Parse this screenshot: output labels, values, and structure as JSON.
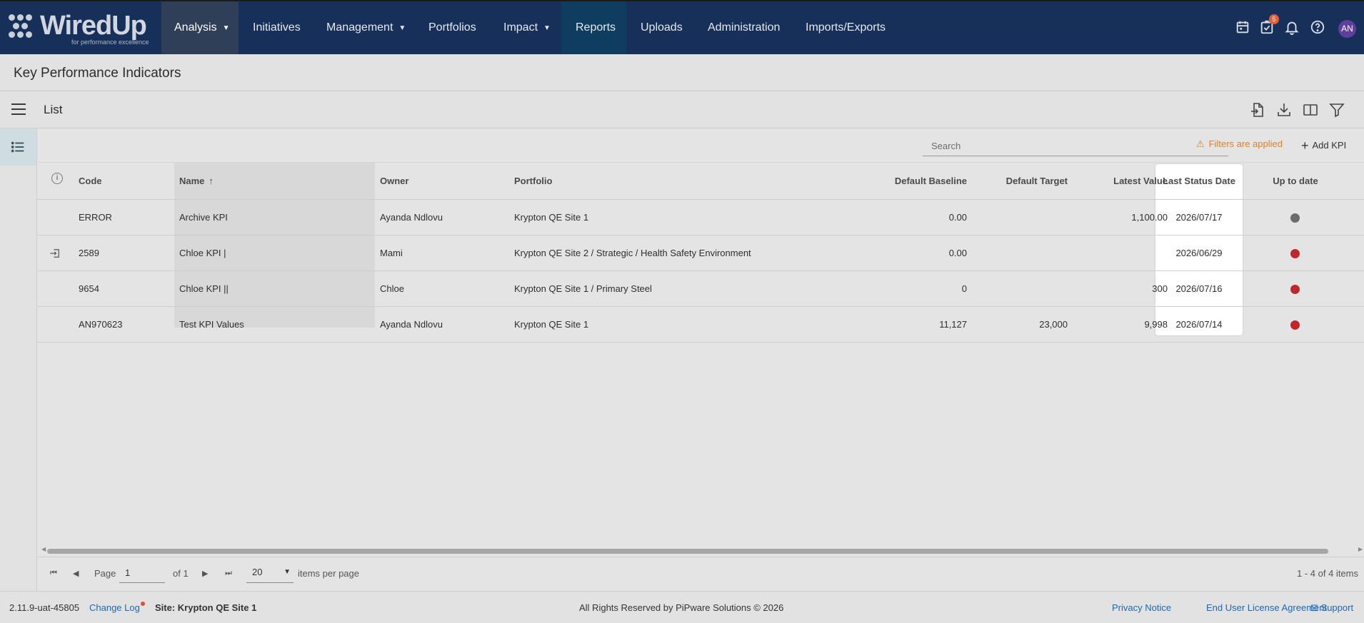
{
  "app": {
    "logo_text": "WiredUp",
    "logo_tagline": "for performance excellence"
  },
  "nav": {
    "items": [
      {
        "label": "Analysis",
        "has_dropdown": true,
        "active": true
      },
      {
        "label": "Initiatives",
        "has_dropdown": false
      },
      {
        "label": "Management",
        "has_dropdown": true
      },
      {
        "label": "Portfolios",
        "has_dropdown": false
      },
      {
        "label": "Impact",
        "has_dropdown": true
      },
      {
        "label": "Reports",
        "has_dropdown": false
      },
      {
        "label": "Uploads",
        "has_dropdown": false
      },
      {
        "label": "Administration",
        "has_dropdown": false
      },
      {
        "label": "Imports/Exports",
        "has_dropdown": false
      }
    ],
    "icons": [
      "calendar-icon",
      "task-list-icon",
      "bell-icon",
      "help-icon"
    ],
    "task_badge": "5",
    "avatar": "AN"
  },
  "page": {
    "title": "Key Performance Indicators",
    "view_title": "List"
  },
  "toolbar": {
    "search_placeholder": "Search",
    "filters_note": "Filters are applied",
    "add_label": "Add KPI"
  },
  "table": {
    "columns": [
      "Code",
      "Name",
      "Owner",
      "Portfolio",
      "Default Baseline",
      "Default Target",
      "Latest Value",
      "Last Status Date",
      "Up to date"
    ],
    "sort": {
      "column": "Name",
      "direction": "asc"
    },
    "rows": [
      {
        "code": "ERROR",
        "name": "Archive KPI",
        "owner": "Ayanda Ndlovu",
        "portfolio": "Krypton QE Site 1",
        "baseline": "0.00",
        "target": "",
        "latest": "1,100.00",
        "status_date": "2026/07/17",
        "up_to_date": "grey",
        "linked": false
      },
      {
        "code": "2589",
        "name": "Chloe KPI |",
        "owner": "Mami",
        "portfolio": "Krypton QE Site 2 / Strategic / Health Safety Environment",
        "baseline": "0.00",
        "target": "",
        "latest": "",
        "status_date": "2026/06/29",
        "up_to_date": "red",
        "linked": true
      },
      {
        "code": "9654",
        "name": "Chloe KPI ||",
        "owner": "Chloe",
        "portfolio": "Krypton QE Site 1 / Primary Steel",
        "baseline": "0",
        "target": "",
        "latest": "300",
        "status_date": "2026/07/16",
        "up_to_date": "red",
        "linked": false
      },
      {
        "code": "AN970623",
        "name": "Test KPI Values",
        "owner": "Ayanda Ndlovu",
        "portfolio": "Krypton QE Site 1",
        "baseline": "11,127",
        "target": "23,000",
        "latest": "9,998",
        "status_date": "2026/07/14",
        "up_to_date": "red",
        "linked": false
      }
    ]
  },
  "pager": {
    "page_label": "Page",
    "page_value": "1",
    "of_label": "of 1",
    "page_size": "20",
    "items_per_page_label": "items per page",
    "summary": "1 - 4 of 4 items"
  },
  "footer": {
    "version": "2.11.9-uat-45805",
    "change_log": "Change Log",
    "site": "Site: Krypton QE Site 1",
    "copyright": "All Rights Reserved by PiPware Solutions © 2026",
    "privacy": "Privacy Notice",
    "eula": "End User License Agreement",
    "support": "Support"
  },
  "colors": {
    "nav_bg": "#17305a",
    "status_red": "#c0262c",
    "status_grey": "#6b6b6b",
    "warning": "#d9822b",
    "link": "#1f67b3"
  }
}
